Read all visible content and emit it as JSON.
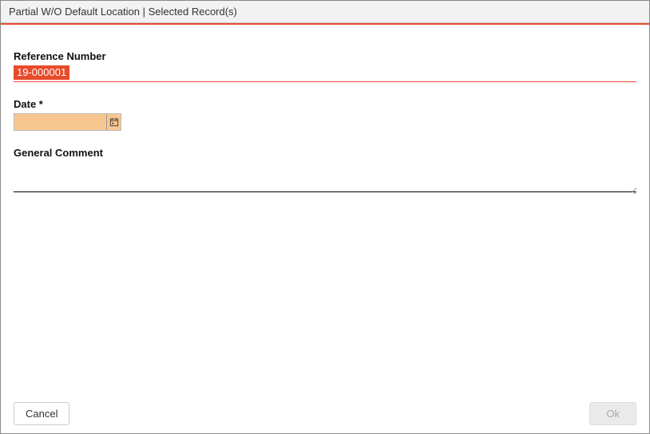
{
  "titlebar": {
    "text": "Partial W/O Default Location | Selected Record(s)"
  },
  "form": {
    "reference": {
      "label": "Reference Number",
      "value": "19-000001"
    },
    "date": {
      "label": "Date *",
      "value": ""
    },
    "comment": {
      "label": "General Comment",
      "value": ""
    }
  },
  "footer": {
    "cancel_label": "Cancel",
    "ok_label": "Ok"
  }
}
